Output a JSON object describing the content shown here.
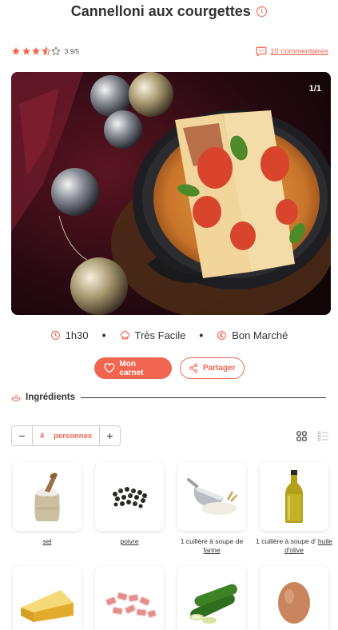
{
  "recipe": {
    "title": "Cannelloni aux courgettes",
    "rating": 3.9,
    "rating_text": "3.9/5",
    "comments_label": "10 commentaires",
    "image_counter": "1/1"
  },
  "meta": {
    "time": "1h30",
    "difficulty": "Très Facile",
    "cost": "Bon Marché",
    "separator": "•"
  },
  "actions": {
    "carnet_label": "Mon carnet",
    "share_label": "Partager"
  },
  "ingredients": {
    "section_title": "Ingrédients",
    "quantity": "4",
    "unit_label": "personnes",
    "minus": "−",
    "plus": "+",
    "items": [
      {
        "prefix": "",
        "name": "sel"
      },
      {
        "prefix": "",
        "name": "poivre"
      },
      {
        "prefix": "1 cuillère à soupe de",
        "name": "farine"
      },
      {
        "prefix": "1 cuillère à soupe d'",
        "name": "huile d'olive"
      }
    ]
  },
  "colors": {
    "accent": "#f26651",
    "text": "#333333"
  },
  "icons": [
    "info-icon",
    "star-icon",
    "comment-icon",
    "clock-icon",
    "chef-hat-icon",
    "euro-coin-icon",
    "heart-icon",
    "share-icon",
    "ingredients-icon",
    "grid-view-icon",
    "list-view-icon"
  ]
}
